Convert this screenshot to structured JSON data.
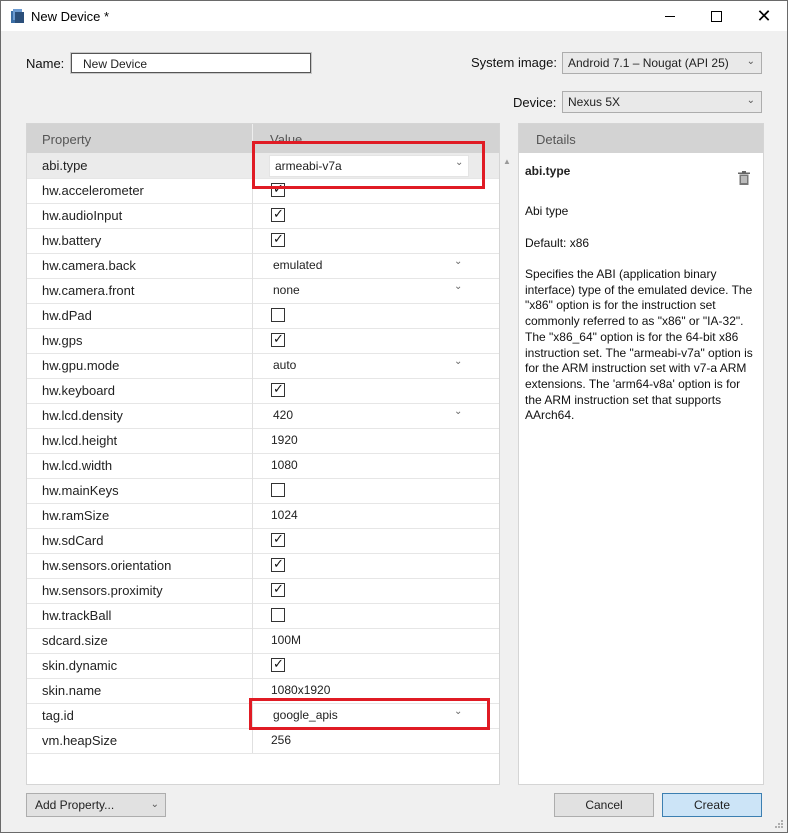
{
  "window": {
    "title": "New Device *"
  },
  "form": {
    "name_label": "Name:",
    "name_value": "New Device",
    "system_image_label": "System image:",
    "system_image_value": "Android 7.1 – Nougat (API 25)",
    "device_label": "Device:",
    "device_value": "Nexus 5X"
  },
  "grid": {
    "col_property": "Property",
    "col_value": "Value",
    "rows": [
      {
        "key": "abi.type",
        "type": "combo",
        "value": "armeabi-v7a"
      },
      {
        "key": "hw.accelerometer",
        "type": "check",
        "checked": true
      },
      {
        "key": "hw.audioInput",
        "type": "check",
        "checked": true
      },
      {
        "key": "hw.battery",
        "type": "check",
        "checked": true
      },
      {
        "key": "hw.camera.back",
        "type": "combo",
        "value": "emulated"
      },
      {
        "key": "hw.camera.front",
        "type": "combo",
        "value": "none"
      },
      {
        "key": "hw.dPad",
        "type": "check",
        "checked": false
      },
      {
        "key": "hw.gps",
        "type": "check",
        "checked": true
      },
      {
        "key": "hw.gpu.mode",
        "type": "combo",
        "value": "auto"
      },
      {
        "key": "hw.keyboard",
        "type": "check",
        "checked": true
      },
      {
        "key": "hw.lcd.density",
        "type": "combo",
        "value": "420"
      },
      {
        "key": "hw.lcd.height",
        "type": "text",
        "value": "1920"
      },
      {
        "key": "hw.lcd.width",
        "type": "text",
        "value": "1080"
      },
      {
        "key": "hw.mainKeys",
        "type": "check",
        "checked": false
      },
      {
        "key": "hw.ramSize",
        "type": "text",
        "value": "1024"
      },
      {
        "key": "hw.sdCard",
        "type": "check",
        "checked": true
      },
      {
        "key": "hw.sensors.orientation",
        "type": "check",
        "checked": true
      },
      {
        "key": "hw.sensors.proximity",
        "type": "check",
        "checked": true
      },
      {
        "key": "hw.trackBall",
        "type": "check",
        "checked": false
      },
      {
        "key": "sdcard.size",
        "type": "text",
        "value": "100M"
      },
      {
        "key": "skin.dynamic",
        "type": "check",
        "checked": true
      },
      {
        "key": "skin.name",
        "type": "text",
        "value": "1080x1920"
      },
      {
        "key": "tag.id",
        "type": "combo",
        "value": "google_apis"
      },
      {
        "key": "vm.heapSize",
        "type": "text",
        "value": "256"
      }
    ]
  },
  "details": {
    "header": "Details",
    "title": "abi.type",
    "subtitle": "Abi type",
    "default": "Default: x86",
    "description_lines": [
      "Specifies the ABI (application binary",
      "interface) type of the emulated device. The",
      "\"x86\" option is for the instruction set",
      "commonly referred to as \"x86\" or \"IA-32\".",
      "The \"x86_64\" option is for the 64-bit x86",
      "instruction set. The \"armeabi-v7a\" option is",
      "for the ARM instruction set with v7-a ARM",
      "extensions. The 'arm64-v8a' option is for",
      "the ARM instruction set that supports",
      "AArch64."
    ]
  },
  "buttons": {
    "add_property": "Add Property...",
    "cancel": "Cancel",
    "create": "Create"
  },
  "colors": {
    "highlight": "#e01b24",
    "primary_button": "#cce4f7"
  }
}
